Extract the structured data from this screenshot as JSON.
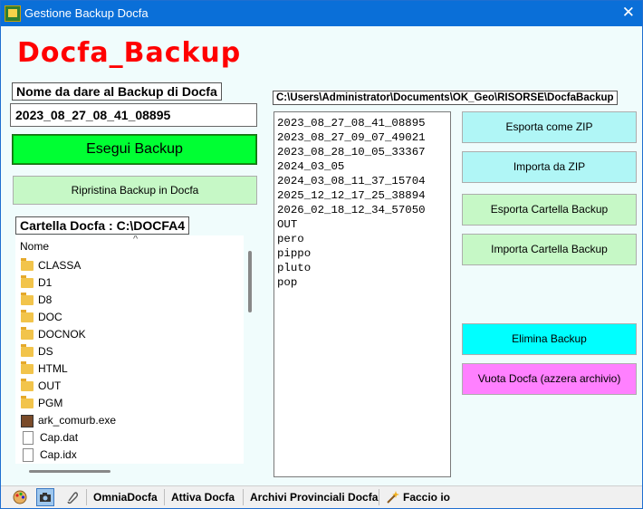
{
  "window": {
    "title": "Gestione Backup Docfa",
    "close_glyph": "✕"
  },
  "brand": "Docfa_Backup",
  "backup_name": {
    "label": "Nome da dare al Backup di Docfa",
    "value": "2023_08_27_08_41_08895"
  },
  "buttons": {
    "esegui": "Esegui Backup",
    "ripristina": "Ripristina Backup in Docfa",
    "esporta_zip": "Esporta come ZIP",
    "importa_zip": "Importa da ZIP",
    "esporta_cartella": "Esporta Cartella Backup",
    "importa_cartella": "Importa Cartella Backup",
    "elimina": "Elimina Backup",
    "vuota": "Vuota Docfa (azzera archivio)"
  },
  "colors": {
    "esegui": "#00ff33",
    "light_green": "#c6f8c6",
    "cyan_light": "#b0f6f6",
    "cyan": "#00ffff",
    "magenta": "#ff80ff"
  },
  "docfa_folder": {
    "label": "Cartella Docfa : C:\\DOCFA4",
    "column_header": "Nome",
    "sort_glyph": "^",
    "items": [
      {
        "name": "CLASSA",
        "type": "folder"
      },
      {
        "name": "D1",
        "type": "folder"
      },
      {
        "name": "D8",
        "type": "folder"
      },
      {
        "name": "DOC",
        "type": "folder"
      },
      {
        "name": "DOCNOK",
        "type": "folder"
      },
      {
        "name": "DS",
        "type": "folder"
      },
      {
        "name": "HTML",
        "type": "folder"
      },
      {
        "name": "OUT",
        "type": "folder"
      },
      {
        "name": "PGM",
        "type": "folder"
      },
      {
        "name": "ark_comurb.exe",
        "type": "exe"
      },
      {
        "name": "Cap.dat",
        "type": "file"
      },
      {
        "name": "Cap.idx",
        "type": "file"
      }
    ]
  },
  "backup_path": "C:\\Users\\Administrator\\Documents\\OK_Geo\\RISORSE\\DocfaBackup",
  "backups": [
    "2023_08_27_08_41_08895",
    "2023_08_27_09_07_49021",
    "2023_08_28_10_05_33367",
    "2024_03_05",
    "2024_03_08_11_37_15704",
    "2025_12_12_17_25_38894",
    "2026_02_18_12_34_57050",
    "OUT",
    "pero",
    "pippo",
    "pluto",
    "pop"
  ],
  "statusbar": {
    "omnia": "OmniaDocfa",
    "attiva": "Attiva Docfa",
    "archivi": "Archivi Provinciali Docfa",
    "faccio": "Faccio io"
  }
}
